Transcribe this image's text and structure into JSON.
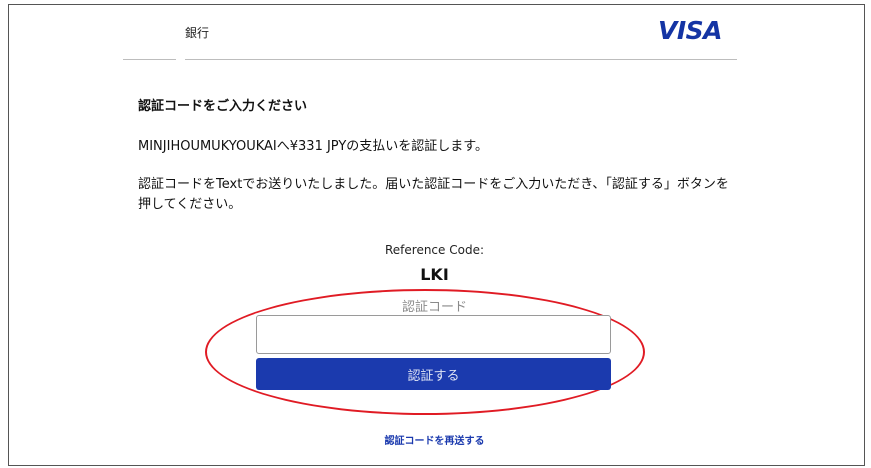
{
  "header": {
    "bank_name": "銀行",
    "brand_logo": "VISA"
  },
  "content": {
    "title": "認証コードをご入力ください",
    "payment_line": "MINJIHOUMUKYOUKAIへ¥331 JPYの支払いを認証します。",
    "instruction": "認証コードをTextでお送りいたしました。届いた認証コードをご入力いただき、「認証する」ボタンを押してください。",
    "reference_label": "Reference Code:",
    "reference_code": "LKI"
  },
  "form": {
    "code_label": "認証コード",
    "code_value": "",
    "submit_label": "認証する",
    "resend_label": "認証コードを再送する"
  },
  "colors": {
    "brand_blue": "#1434a4",
    "button_blue": "#1b3aae",
    "highlight_red": "#e01b24"
  }
}
